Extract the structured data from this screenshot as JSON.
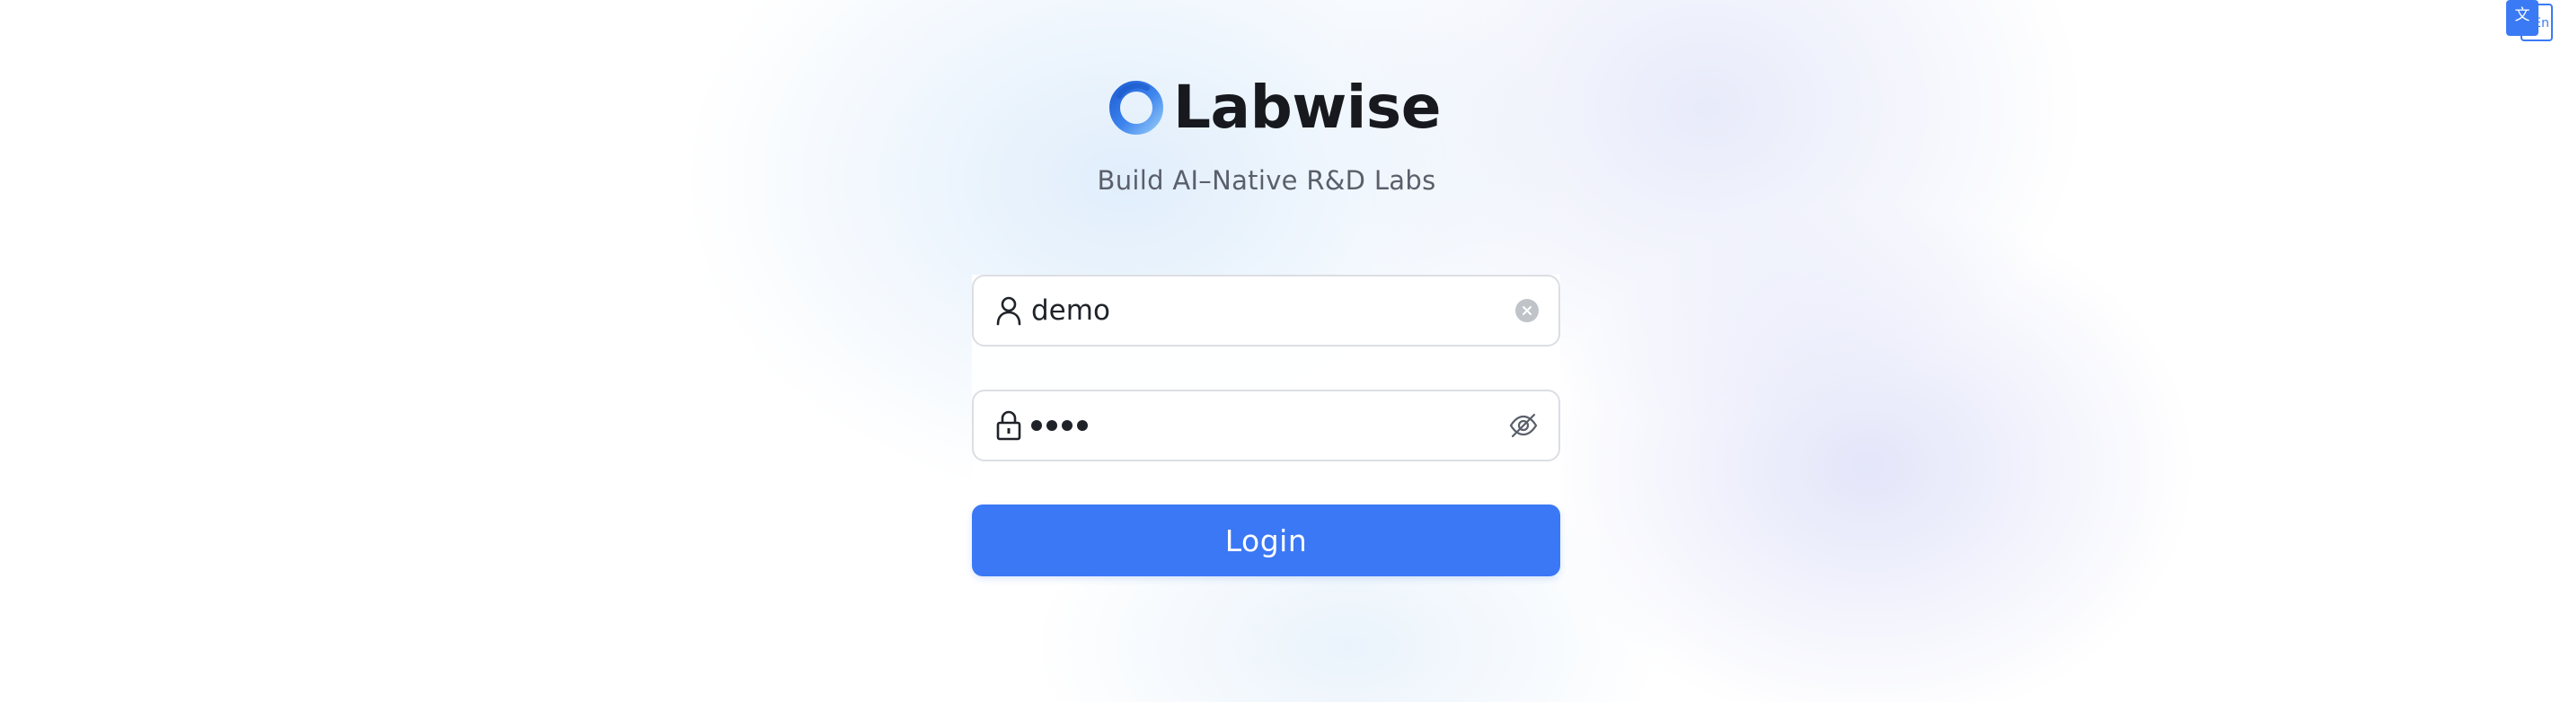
{
  "language_switch": {
    "front_glyph": "文",
    "back_glyph": "En"
  },
  "brand": {
    "name": "Labwise",
    "tagline": "Build AI–Native R&D Labs",
    "logo_icon": "ring-logo-icon"
  },
  "login_form": {
    "username": {
      "icon": "user-icon",
      "value": "demo",
      "clear_icon": "clear-icon"
    },
    "password": {
      "icon": "lock-icon",
      "masked_length": 4,
      "visibility_icon": "eye-off-icon"
    },
    "submit_label": "Login"
  },
  "colors": {
    "primary": "#3b78f5",
    "text": "#17191f",
    "muted": "#5a5f6b",
    "border": "#dcdee3"
  }
}
